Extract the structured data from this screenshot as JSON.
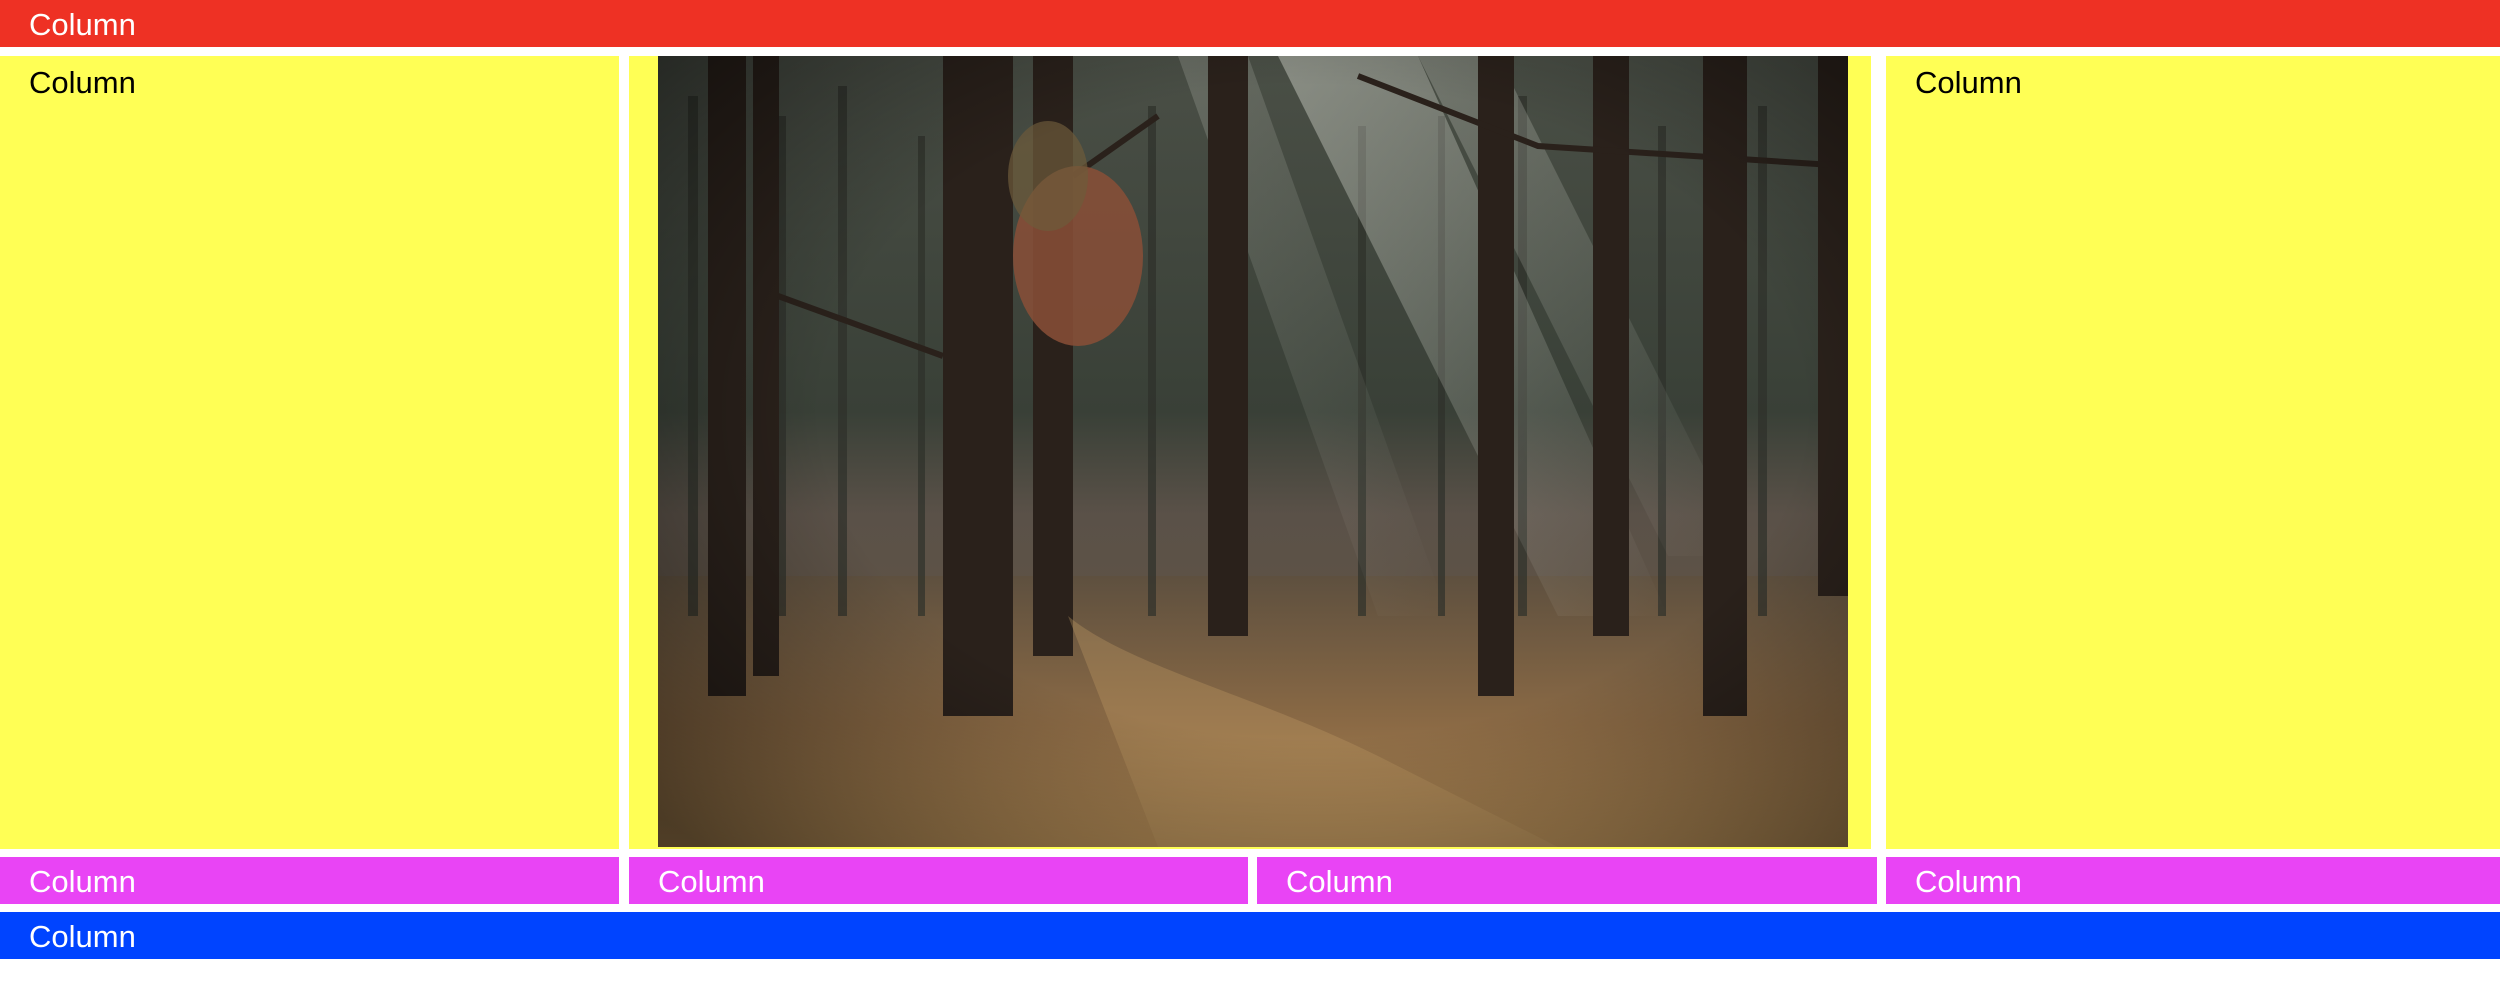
{
  "layout": {
    "top_bar": {
      "label": "Column",
      "color": "#ee3124"
    },
    "middle": {
      "left": {
        "label": "Column",
        "color": "#ffff55"
      },
      "center": {
        "image": "forest-photo",
        "color": "#ffff55"
      },
      "right": {
        "label": "Column",
        "color": "#ffff55"
      }
    },
    "row": [
      {
        "label": "Column",
        "color": "#e944f5"
      },
      {
        "label": "Column",
        "color": "#e944f5"
      },
      {
        "label": "Column",
        "color": "#e944f5"
      },
      {
        "label": "Column",
        "color": "#e944f5"
      }
    ],
    "bottom_bar": {
      "label": "Column",
      "color": "#0044ff"
    }
  }
}
